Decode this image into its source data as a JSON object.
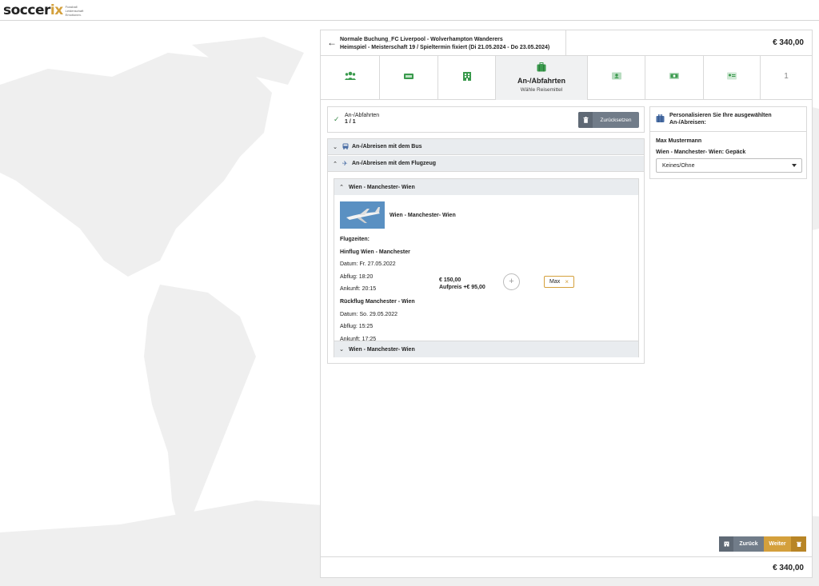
{
  "logo": {
    "brand_main": "soccer",
    "brand_accent": "ix",
    "tagline_1": "Fussball",
    "tagline_2": "Leidenschaft",
    "tagline_3": "Emotionen."
  },
  "header": {
    "title_line1": "Normale Buchung_FC Liverpool - Wolverhampton Wanderers",
    "title_line2": "Heimspiel - Meisterschaft 19 / Spieltermin fixiert (Di 21.05.2024 - Do 23.05.2024)",
    "total_price": "€ 340,00"
  },
  "steps": [
    {
      "icon": "people-icon"
    },
    {
      "icon": "ticket-icon"
    },
    {
      "icon": "hotel-icon"
    },
    {
      "icon": "luggage-icon",
      "label": "An-/Abfahrten",
      "sublabel": "Wähle Reisemittel"
    },
    {
      "icon": "person-card-icon"
    },
    {
      "icon": "money-icon"
    },
    {
      "icon": "id-card-icon"
    },
    {
      "label": "1"
    }
  ],
  "status": {
    "title": "An-/Abfahrten",
    "count": "1 / 1",
    "reset_label": "Zurücksetzen"
  },
  "sections": {
    "bus_label": "An-/Abreisen mit dem Bus",
    "plane_label": "An-/Abreisen mit dem Flugzeug"
  },
  "flight_group": {
    "header": "Wien - Manchester- Wien",
    "flight_name": "Wien - Manchester- Wien",
    "times_label": "Flugzeiten:",
    "outbound_title": "Hinflug Wien - Manchester",
    "outbound_date": "Datum: Fr. 27.05.2022",
    "outbound_departure": "Abflug: 18:20",
    "outbound_arrival": "Ankunft: 20:15",
    "return_title": "Rückflug Manchester - Wien",
    "return_date": "Datum: So. 29.05.2022",
    "return_departure": "Abflug: 15:25",
    "return_arrival": "Ankunft: 17:25",
    "price": "€ 150,00",
    "surcharge": "Aufpreis +€ 95,00",
    "add_symbol": "+",
    "assigned_person": "Max",
    "remove_symbol": "×",
    "second_header": "Wien - Manchester- Wien"
  },
  "personalize": {
    "title": "Personalisieren Sie Ihre ausgewählten An-/Abreisen:",
    "person_name": "Max Mustermann",
    "field_label": "Wien - Manchester- Wien: Gepäck",
    "selected_option": "Keines/Ohne"
  },
  "footer": {
    "back_label": "Zurück",
    "next_label": "Weiter",
    "total_price": "€ 340,00"
  },
  "colors": {
    "accent_gold": "#d4a03c",
    "icon_green": "#3a9a4d",
    "button_gray": "#717c89"
  }
}
